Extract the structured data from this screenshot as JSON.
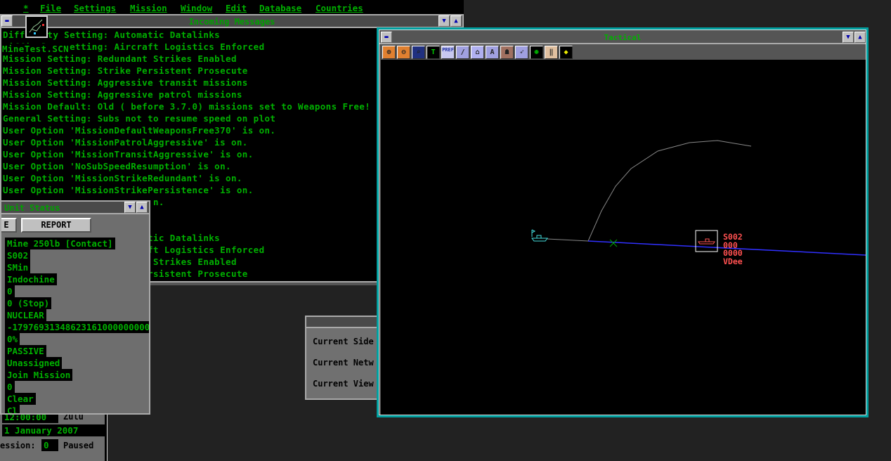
{
  "menu": {
    "items": [
      "*",
      "File",
      "Settings",
      "Mission",
      "Window",
      "Edit",
      "Database",
      "Countries"
    ]
  },
  "messages": {
    "title": "Incoming Messages",
    "scenario_label": "MineTest.SCN",
    "lines": [
      "Difficulty Setting: Automatic Datalinks",
      "Difficulty Setting: Aircraft Logistics Enforced",
      "Mission Setting: Redundant Strikes Enabled",
      "Mission Setting: Strike Persistent Prosecute",
      "Mission Setting: Aggressive transit missions",
      "Mission Setting: Aggressive patrol missions",
      "Mission Default: Old ( before 3.7.0) missions set to Weapons Free!",
      "General Setting: Subs not to resume speed on plot",
      "User Option 'MissionDefaultWeaponsFree370' is on.",
      "User Option 'MissionPatrolAggressive' is on.",
      "User Option 'MissionTransitAggressive' is on.",
      "User Option 'NoSubSpeedResumption' is on.",
      "User Option 'MissionStrikeRedundant' is on.",
      "User Option 'MissionStrikePersistence' is on.",
      "                           n.",
      "",
      "",
      "Difficulty Setting: Automatic Datalinks",
      "Difficulty Setting: Aircraft Logistics Enforced",
      "Mission Setting: Redundant Strikes Enabled",
      "Mission Setting: Strike Persistent Prosecute"
    ]
  },
  "unit_status": {
    "title": "Unit Status",
    "button_left": "E",
    "button_report": "REPORT",
    "fields": [
      "Mine 250lb [Contact]",
      "S002",
      "SMin",
      "Indochine",
      "0",
      "0 (Stop)",
      "NUCLEAR",
      "-17976931348623161000000000",
      "0%",
      "PASSIVE",
      "Unassigned",
      "Join Mission",
      "0",
      "Clear",
      "Cl"
    ]
  },
  "time": {
    "clock": "12:00:00",
    "zone": "Zulu",
    "date": "1 January 2007",
    "session_label": "ession:",
    "session_value": "0",
    "state": "Paused"
  },
  "dialog": {
    "lines": [
      "Current Side",
      "Current Netw",
      "Current View"
    ]
  },
  "tactical": {
    "title": "Tactical",
    "toolbar": [
      "zoom-in",
      "zoom-out",
      "zoom-find",
      "range",
      "PREF",
      "weapon",
      "radar",
      "tower",
      "commander",
      "missile",
      "target",
      "ammo",
      "tag"
    ],
    "contact": {
      "lines": [
        "S002",
        "000",
        "0000",
        "VDee"
      ],
      "color": "#ff5050"
    }
  },
  "colors": {
    "text_green": "#00b000",
    "frame_teal": "#00a0a0",
    "track_blue": "#3030ff"
  }
}
